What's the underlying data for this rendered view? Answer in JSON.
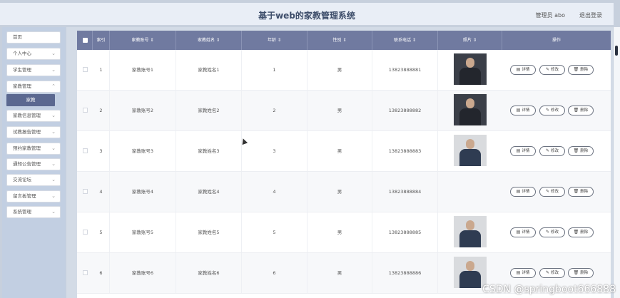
{
  "header": {
    "title": "基于web的家教管理系统",
    "user": "管理员 abo",
    "logout": "退出登录"
  },
  "sidebar": {
    "items": [
      {
        "label": "首页",
        "chevron": false
      },
      {
        "label": "个人中心",
        "chevron": true
      },
      {
        "label": "学生管理",
        "chevron": true
      },
      {
        "label": "家教管理",
        "chevron": true
      },
      {
        "label": "家教信息管理",
        "chevron": true
      },
      {
        "label": "试教报告管理",
        "chevron": true
      },
      {
        "label": "预约家教管理",
        "chevron": true
      },
      {
        "label": "通知公告管理",
        "chevron": true
      },
      {
        "label": "交流论坛",
        "chevron": true
      },
      {
        "label": "留言板管理",
        "chevron": true
      },
      {
        "label": "系统管理",
        "chevron": true
      }
    ],
    "submenu": "家教"
  },
  "table": {
    "columns": [
      "索引",
      "家教账号",
      "家教姓名",
      "年龄",
      "性别",
      "联系电话",
      "照片",
      "操作"
    ],
    "rows": [
      {
        "index": "1",
        "account": "家教账号1",
        "name": "家教姓名1",
        "age": "1",
        "gender": "男",
        "phone": "13823888881",
        "photo": "dark"
      },
      {
        "index": "2",
        "account": "家教账号2",
        "name": "家教姓名2",
        "age": "2",
        "gender": "男",
        "phone": "13823888882",
        "photo": "dark"
      },
      {
        "index": "3",
        "account": "家教账号3",
        "name": "家教姓名3",
        "age": "3",
        "gender": "男",
        "phone": "13823888883",
        "photo": "light"
      },
      {
        "index": "4",
        "account": "家教账号4",
        "name": "家教姓名4",
        "age": "4",
        "gender": "男",
        "phone": "13823888884",
        "photo": ""
      },
      {
        "index": "5",
        "account": "家教账号5",
        "name": "家教姓名5",
        "age": "5",
        "gender": "男",
        "phone": "13823888885",
        "photo": "light"
      },
      {
        "index": "6",
        "account": "家教账号6",
        "name": "家教姓名6",
        "age": "6",
        "gender": "男",
        "phone": "13823888886",
        "photo": "light"
      }
    ],
    "actions": {
      "detail": "详情",
      "edit": "修改",
      "delete": "删除"
    }
  },
  "watermark": "CSDN @springboot666888"
}
